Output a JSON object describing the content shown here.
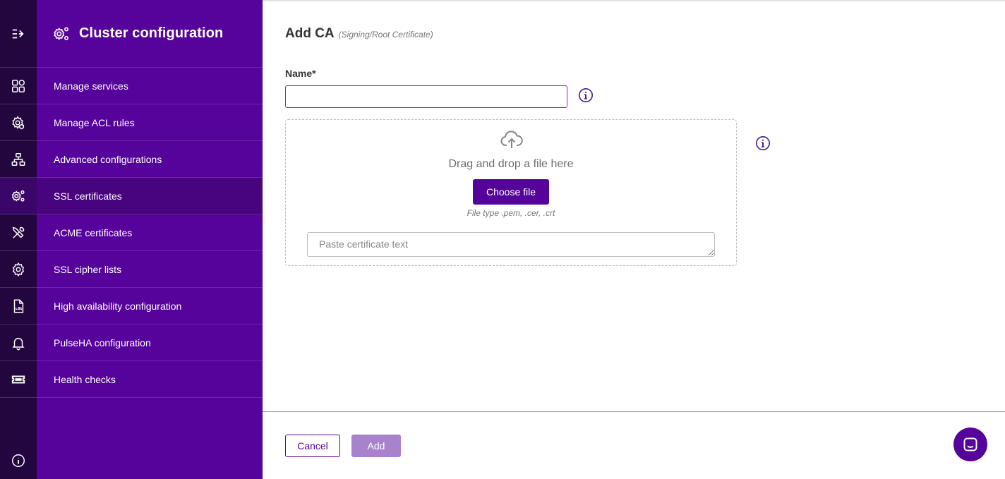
{
  "sidebar": {
    "title": "Cluster configuration",
    "items": [
      {
        "label": "Manage services",
        "icon": "grid-icon"
      },
      {
        "label": "Manage ACL rules",
        "icon": "gear-shield-icon"
      },
      {
        "label": "Advanced configurations",
        "icon": "network-icon"
      },
      {
        "label": "SSL certificates",
        "icon": "gears-icon",
        "active": true
      },
      {
        "label": "ACME certificates",
        "icon": "tools-icon"
      },
      {
        "label": "SSL cipher lists",
        "icon": "gear-icon"
      },
      {
        "label": "High availability configuration",
        "icon": "log-file-icon"
      },
      {
        "label": "PulseHA configuration",
        "icon": "bell-icon"
      },
      {
        "label": "Health checks",
        "icon": "ticket-icon"
      }
    ]
  },
  "form": {
    "title": "Add CA",
    "subtitle": "(Signing/Root Certificate)",
    "name_label": "Name*",
    "name_value": "",
    "drop_text": "Drag and drop a file here",
    "choose_file": "Choose file",
    "file_types": "File type .pem, .cer, .crt",
    "paste_placeholder": "Paste certificate text"
  },
  "footer": {
    "cancel": "Cancel",
    "add": "Add"
  },
  "colors": {
    "rail": "#24063f",
    "sidebar": "#56039b",
    "sidebar_active": "#48037f",
    "primary": "#56039b",
    "disabled_button": "#a882cd"
  }
}
